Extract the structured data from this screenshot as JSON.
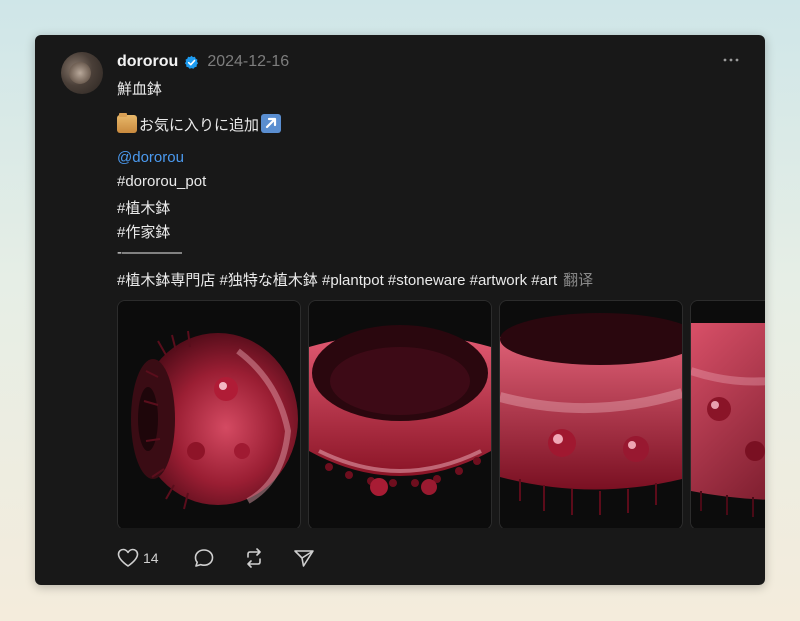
{
  "post": {
    "username": "dororou",
    "date": "2024-12-16",
    "lines": {
      "title": "鮮血鉢",
      "favorite": "お気に入りに追加",
      "mention": "@dororou",
      "tag1": "#dororou_pot",
      "tag2": "#植木鉢",
      "tag3": "#作家鉢",
      "divider": "-————",
      "tags_row": "#植木鉢専門店 #独特な植木鉢 #plantpot #stoneware #artwork #art",
      "translate": "翻译"
    },
    "likes": "14",
    "icons": [
      "verified-badge-icon",
      "more-options-icon",
      "folder-emoji-icon",
      "arrow-up-right-emoji-icon",
      "heart-icon",
      "comment-icon",
      "repost-icon",
      "share-icon"
    ],
    "images": [
      "bowl-side-view",
      "bowl-top-view",
      "bowl-rim-closeup",
      "bowl-partial"
    ]
  },
  "colors": {
    "card_bg": "#181818",
    "mention": "#4b9af0",
    "verified": "#1d9bf0"
  }
}
